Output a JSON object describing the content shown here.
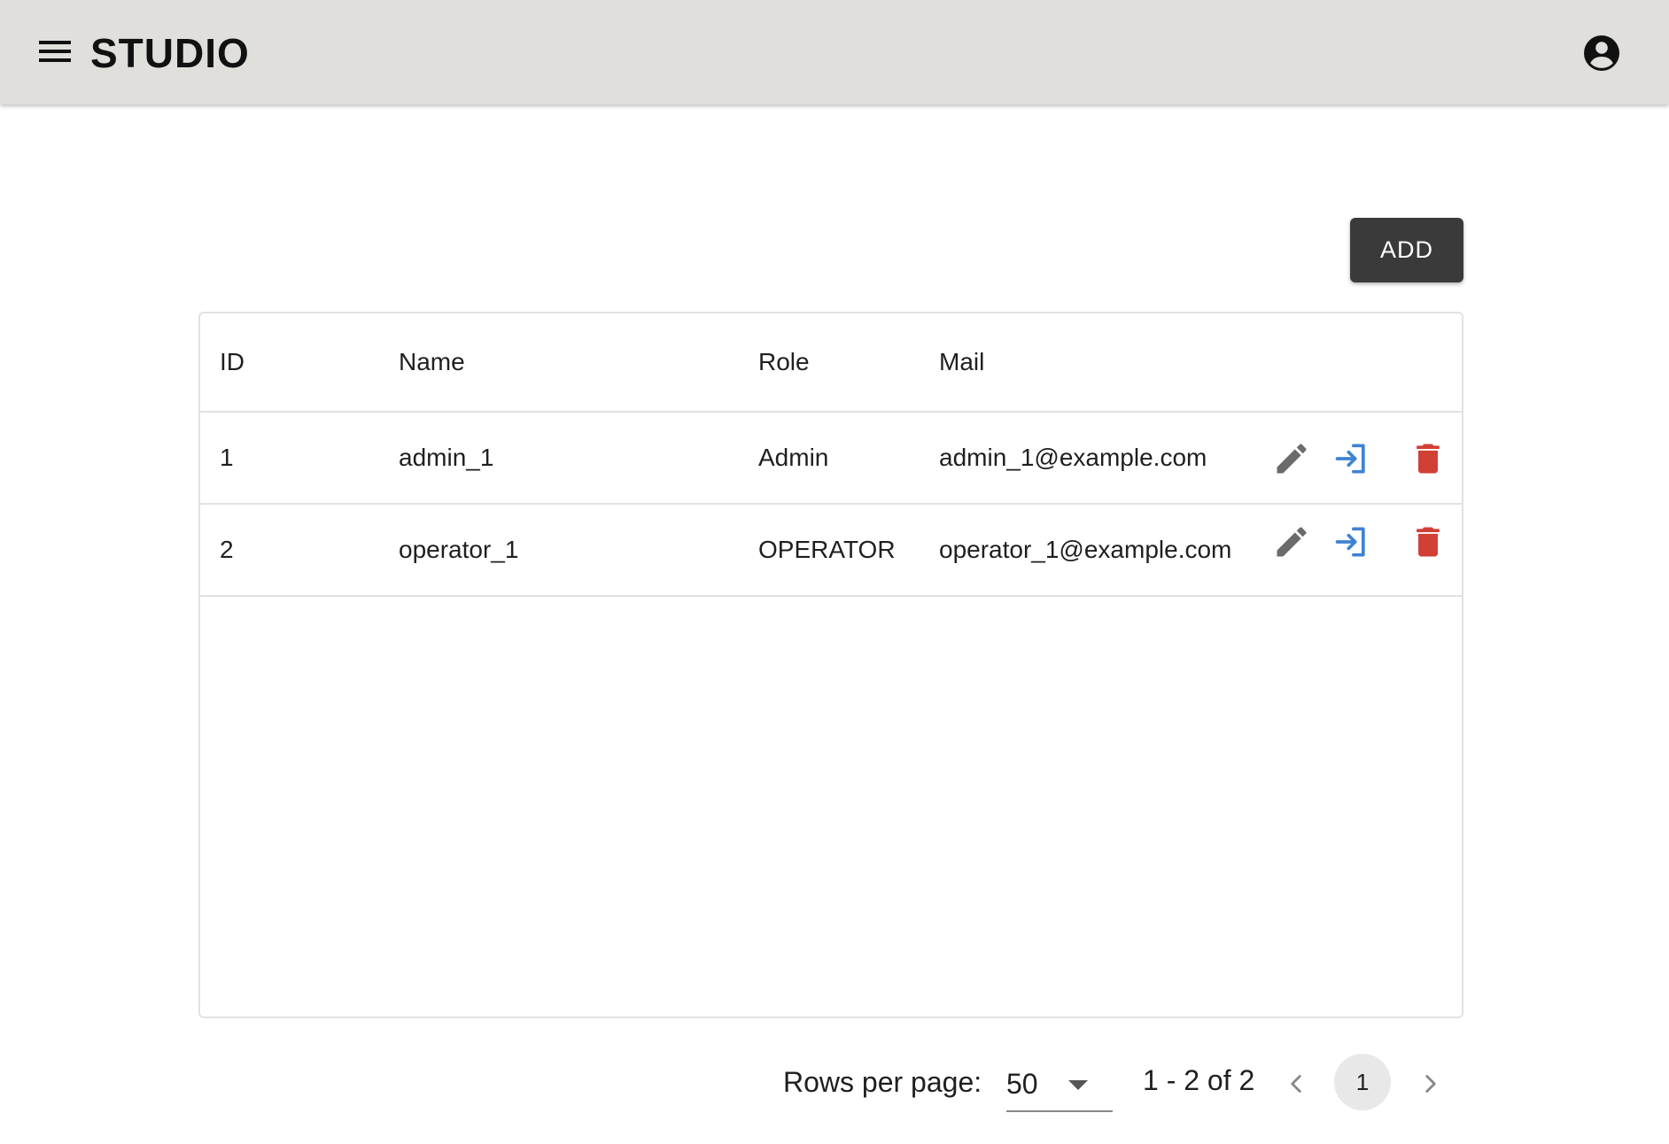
{
  "header": {
    "title": "STUDIO",
    "menu_icon": "menu-icon",
    "account_icon": "account-circle-icon"
  },
  "toolbar": {
    "add_label": "ADD"
  },
  "table": {
    "columns": [
      "ID",
      "Name",
      "Role",
      "Mail"
    ],
    "rows": [
      {
        "id": "1",
        "name": "admin_1",
        "role": "Admin",
        "mail": "admin_1@example.com"
      },
      {
        "id": "2",
        "name": "operator_1",
        "role": "OPERATOR",
        "mail": "operator_1@example.com"
      }
    ],
    "row_actions": [
      "edit-icon",
      "login-icon",
      "delete-icon"
    ]
  },
  "pagination": {
    "rows_per_page_label": "Rows per page:",
    "rows_per_page_value": "50",
    "range_text": "1 - 2 of 2",
    "current_page": "1"
  },
  "colors": {
    "appbar_bg": "#e0dfdc",
    "add_button_bg": "#3a3a3a",
    "edit_icon": "#6b6b6b",
    "login_icon": "#3f82d1",
    "delete_icon": "#d23f34"
  }
}
